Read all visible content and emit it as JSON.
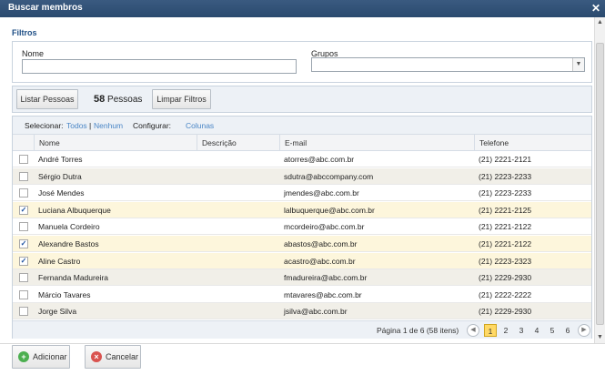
{
  "dialog": {
    "title": "Buscar membros"
  },
  "filters": {
    "section_title": "Filtros",
    "nome_label": "Nome",
    "nome_value": "",
    "grupos_label": "Grupos",
    "grupos_value": ""
  },
  "toolbar": {
    "listar_label": "Listar Pessoas",
    "count_value": "58",
    "count_unit": "Pessoas",
    "limpar_label": "Limpar Filtros"
  },
  "grid": {
    "selecionar_label": "Selecionar:",
    "todos_link": "Todos",
    "separator": "|",
    "nenhum_link": "Nenhum",
    "configurar_label": "Configurar:",
    "colunas_link": "Colunas",
    "columns": [
      "Nome",
      "Descrição",
      "E-mail",
      "Telefone"
    ],
    "rows": [
      {
        "checked": false,
        "nome": "André Torres",
        "descricao": "",
        "email": "atorres@abc.com.br",
        "telefone": "(21) 2221-2121"
      },
      {
        "checked": false,
        "nome": "Sérgio Dutra",
        "descricao": "",
        "email": "sdutra@abccompany.com",
        "telefone": "(21) 2223-2233"
      },
      {
        "checked": false,
        "nome": "José Mendes",
        "descricao": "",
        "email": "jmendes@abc.com.br",
        "telefone": "(21) 2223-2233"
      },
      {
        "checked": true,
        "nome": "Luciana Albuquerque",
        "descricao": "",
        "email": "lalbuquerque@abc.com.br",
        "telefone": "(21) 2221-2125"
      },
      {
        "checked": false,
        "nome": "Manuela Cordeiro",
        "descricao": "",
        "email": "mcordeiro@abc.com.br",
        "telefone": "(21) 2221-2122"
      },
      {
        "checked": true,
        "nome": "Alexandre Bastos",
        "descricao": "",
        "email": "abastos@abc.com.br",
        "telefone": "(21) 2221-2122"
      },
      {
        "checked": true,
        "nome": "Aline Castro",
        "descricao": "",
        "email": "acastro@abc.com.br",
        "telefone": "(21) 2223-2323"
      },
      {
        "checked": false,
        "nome": "Fernanda Madureira",
        "descricao": "",
        "email": "fmadureira@abc.com.br",
        "telefone": "(21) 2229-2930"
      },
      {
        "checked": false,
        "nome": "Márcio Tavares",
        "descricao": "",
        "email": "mtavares@abc.com.br",
        "telefone": "(21) 2222-2222"
      },
      {
        "checked": false,
        "nome": "Jorge Silva",
        "descricao": "",
        "email": "jsilva@abc.com.br",
        "telefone": "(21) 2229-2930"
      }
    ],
    "pager": {
      "info": "Página 1 de 6 (58 itens)",
      "pages": [
        "1",
        "2",
        "3",
        "4",
        "5",
        "6"
      ],
      "current_page": "1"
    }
  },
  "footer": {
    "add_label": "Adicionar",
    "cancel_label": "Cancelar"
  },
  "colors": {
    "titlebar": "#2f4f75",
    "link": "#4a86c6",
    "selected_row": "#fdf6dc",
    "accent_section": "#1f4f86"
  },
  "icons": [
    "close-icon",
    "chevron-down-icon",
    "checkmark-icon",
    "arrow-left-icon",
    "arrow-right-icon",
    "add-icon",
    "cancel-icon"
  ]
}
